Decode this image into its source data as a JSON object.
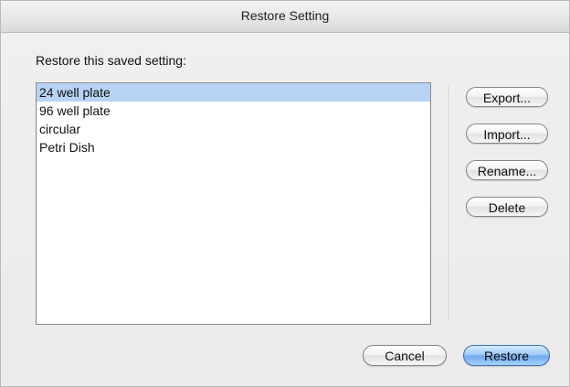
{
  "window": {
    "title": "Restore Setting"
  },
  "prompt": "Restore this saved setting:",
  "list": {
    "items": [
      "24 well plate",
      "96 well plate",
      "circular",
      "Petri Dish"
    ],
    "selected": "24 well plate"
  },
  "side_buttons": {
    "export": "Export...",
    "import": "Import...",
    "rename": "Rename...",
    "delete": "Delete"
  },
  "bottom_buttons": {
    "cancel": "Cancel",
    "restore": "Restore"
  },
  "colors": {
    "selection": "#b7d3f4",
    "default_button": "#6faaeb"
  }
}
